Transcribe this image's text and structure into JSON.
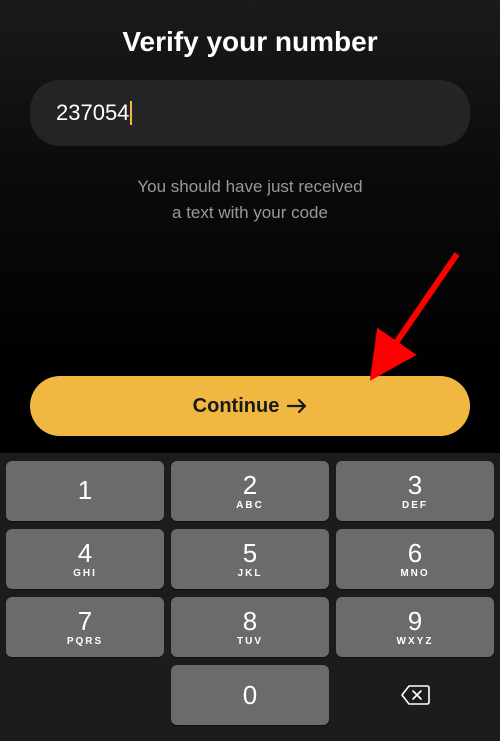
{
  "title": "Verify your number",
  "code_input": {
    "value": "237054"
  },
  "helper_text_line1": "You should have just received",
  "helper_text_line2": "a text with your code",
  "continue_button": {
    "label": "Continue"
  },
  "keypad": {
    "keys": [
      {
        "num": "1",
        "letters": ""
      },
      {
        "num": "2",
        "letters": "ABC"
      },
      {
        "num": "3",
        "letters": "DEF"
      },
      {
        "num": "4",
        "letters": "GHI"
      },
      {
        "num": "5",
        "letters": "JKL"
      },
      {
        "num": "6",
        "letters": "MNO"
      },
      {
        "num": "7",
        "letters": "PQRS"
      },
      {
        "num": "8",
        "letters": "TUV"
      },
      {
        "num": "9",
        "letters": "WXYZ"
      },
      {
        "num": "0",
        "letters": ""
      }
    ]
  },
  "colors": {
    "accent": "#f0b840"
  }
}
